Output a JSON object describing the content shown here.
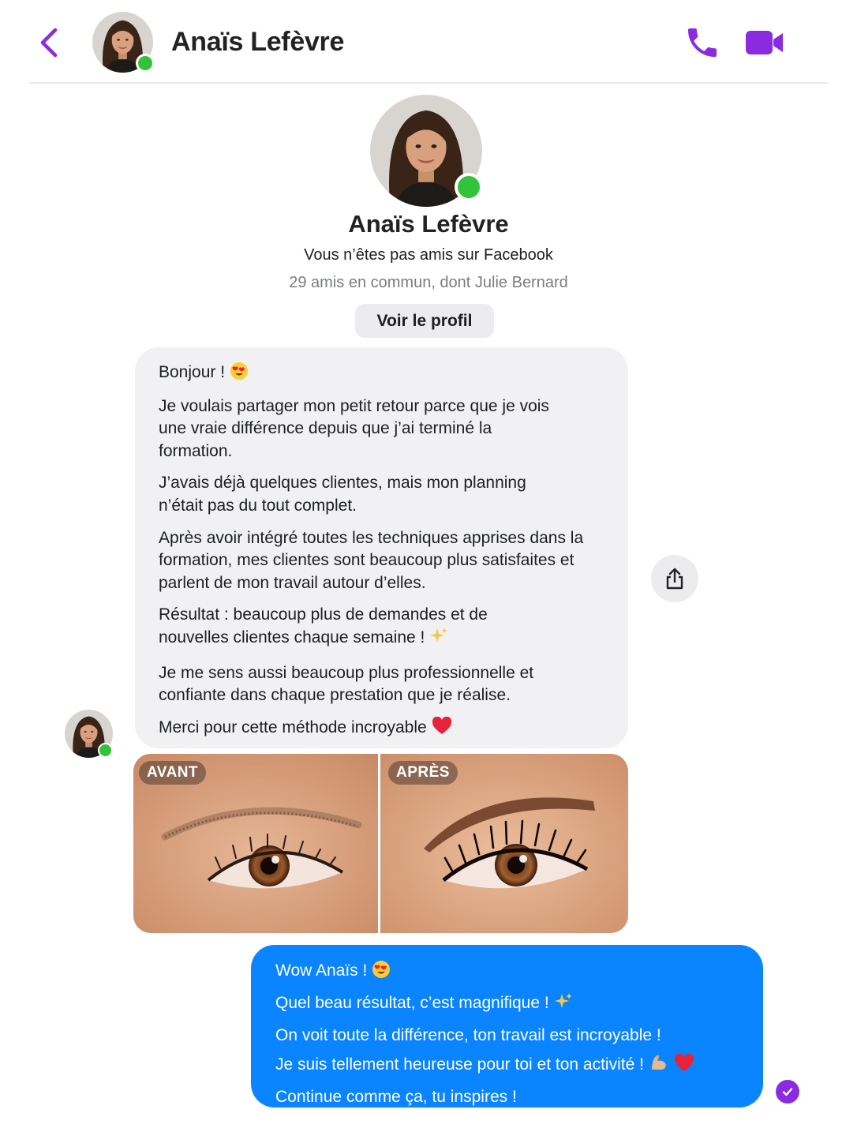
{
  "header": {
    "contact_name": "Anaïs Lefèvre",
    "back_icon": "chevron-left-icon",
    "call_icon": "phone-icon",
    "video_icon": "video-camera-icon",
    "online": true
  },
  "profile": {
    "name": "Anaïs Lefèvre",
    "relation": "Vous n’êtes pas amis sur Facebook",
    "mutual": "29 amis en commun, dont Julie Bernard",
    "view_profile_label": "Voir le profil"
  },
  "received_message": {
    "greeting": "Bonjour !",
    "paragraphs": [
      "Je voulais partager mon petit retour parce que je vois une vraie différence depuis que j’ai terminé la formation.",
      "J’avais déjà quelques clientes, mais mon planning n’était pas du tout complet.",
      "Après avoir intégré toutes les techniques apprises dans la formation, mes clientes sont beaucoup plus satisfaites et parlent de mon travail autour d’elles.",
      "Résultat : beaucoup plus de demandes et de nouvelles clientes chaque semaine !",
      "Je me sens aussi beaucoup plus professionnelle et confiante dans chaque prestation que je réalise.",
      "Merci pour cette méthode incroyable"
    ]
  },
  "photos": {
    "before_label": "AVANT",
    "after_label": "APRÈS"
  },
  "sent_message": {
    "lines": [
      "Wow Anaïs !",
      "Quel beau résultat, c’est magnifique !",
      "On voit toute la différence, ton travail est incroyable !",
      "Je suis tellement heureuse pour toi et ton activité !",
      "Continue comme ça, tu inspires !"
    ]
  },
  "colors": {
    "accent": "#8a2be2",
    "sent_bubble": "#0a84ff",
    "received_bubble": "#f1f1f3",
    "online": "#31c43a"
  }
}
